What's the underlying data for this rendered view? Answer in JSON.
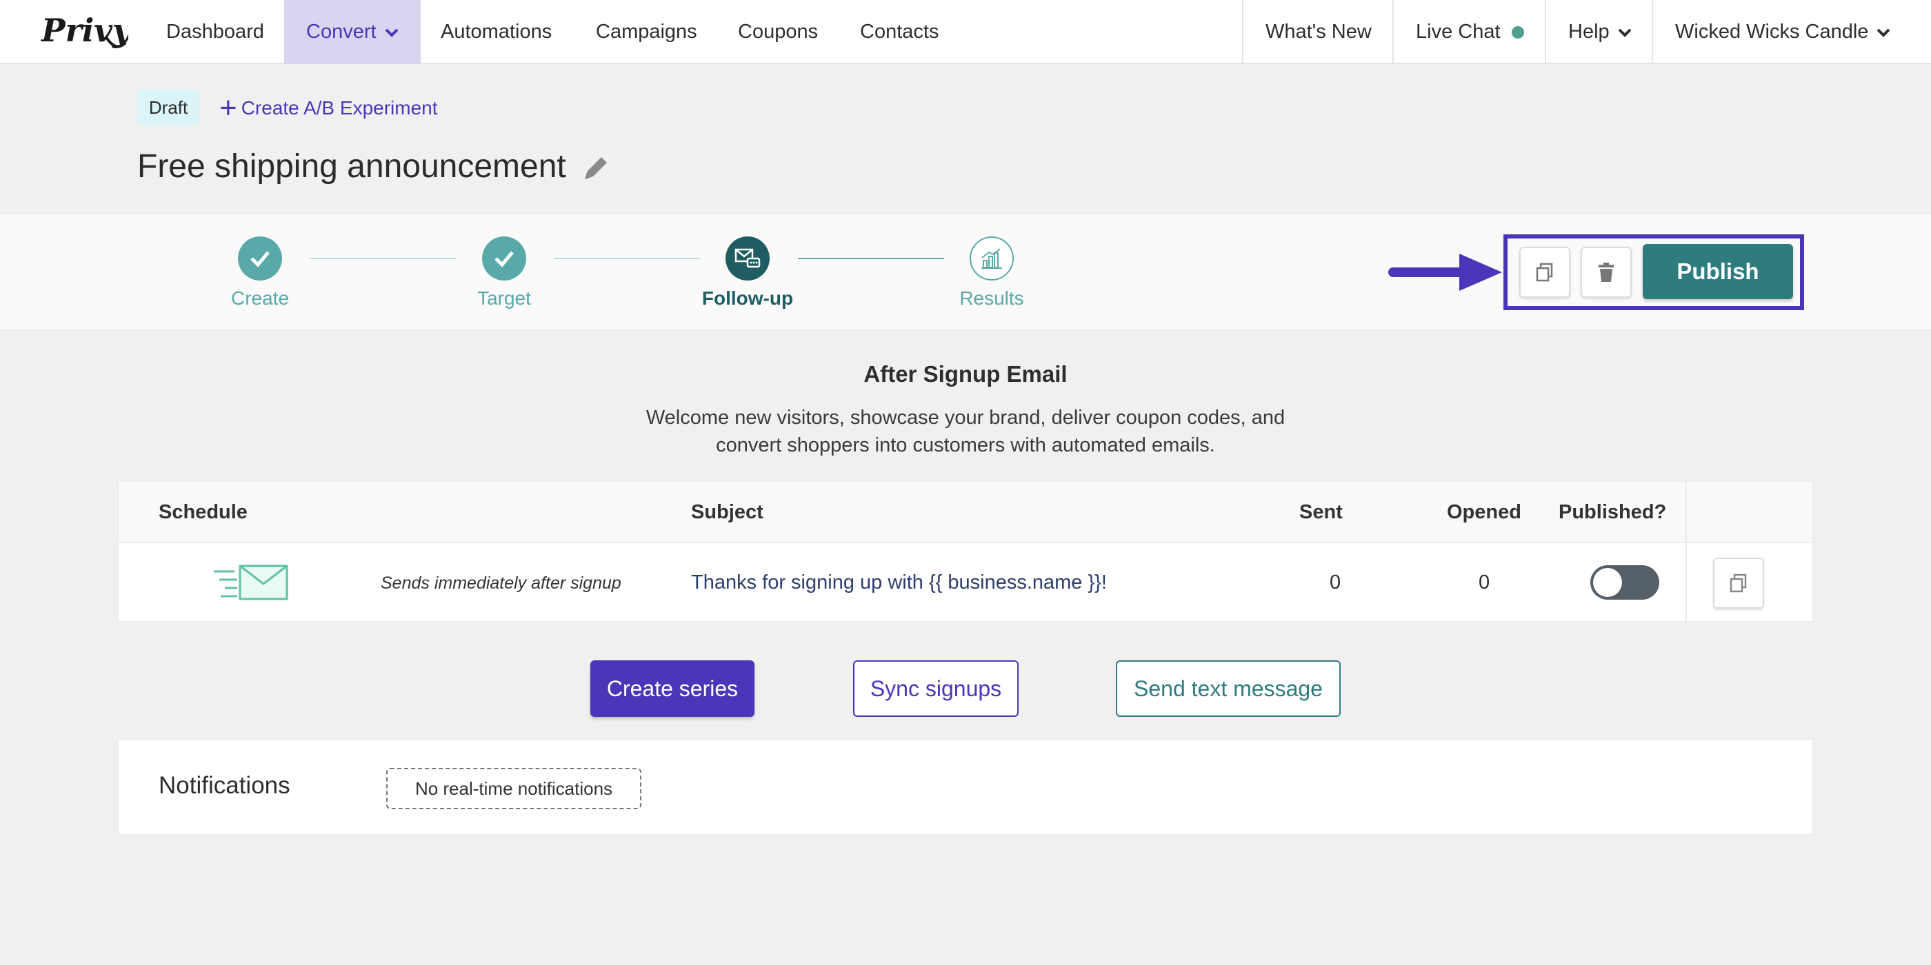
{
  "app": {
    "logo_text": "Privy"
  },
  "nav": {
    "items": [
      {
        "label": "Dashboard"
      },
      {
        "label": "Convert"
      },
      {
        "label": "Automations"
      },
      {
        "label": "Campaigns"
      },
      {
        "label": "Coupons"
      },
      {
        "label": "Contacts"
      }
    ],
    "right": {
      "whats_new": "What's New",
      "live_chat": "Live Chat",
      "help": "Help",
      "account": "Wicked Wicks Candle"
    },
    "active_item": "Convert"
  },
  "header": {
    "status_badge": "Draft",
    "ab_link": "Create A/B Experiment",
    "title": "Free shipping announcement"
  },
  "stepper": {
    "steps": [
      {
        "label": "Create",
        "state": "complete"
      },
      {
        "label": "Target",
        "state": "complete"
      },
      {
        "label": "Follow-up",
        "state": "current"
      },
      {
        "label": "Results",
        "state": "upcoming"
      }
    ]
  },
  "actions": {
    "copy_icon": "copy-icon",
    "delete_icon": "trash-icon",
    "publish_label": "Publish"
  },
  "section": {
    "title": "After Signup Email",
    "description": "Welcome new visitors, showcase your brand, deliver coupon codes, and convert shoppers into customers with automated emails."
  },
  "table": {
    "headers": {
      "schedule": "Schedule",
      "subject": "Subject",
      "sent": "Sent",
      "opened": "Opened",
      "published": "Published?"
    },
    "rows": [
      {
        "schedule_icon": "email-sending-icon",
        "schedule": "Sends immediately after signup",
        "subject": "Thanks for signing up with {{ business.name }}!",
        "sent": "0",
        "opened": "0",
        "published": false
      }
    ]
  },
  "buttons": {
    "create_series": "Create series",
    "sync_signups": "Sync signups",
    "send_text": "Send text message"
  },
  "notifications": {
    "title": "Notifications",
    "empty": "No real-time notifications"
  },
  "colors": {
    "brand_purple": "#4a36b8",
    "teal": "#2f7c7f",
    "step_complete": "#5aa9a9",
    "step_current": "#1f5d63"
  }
}
